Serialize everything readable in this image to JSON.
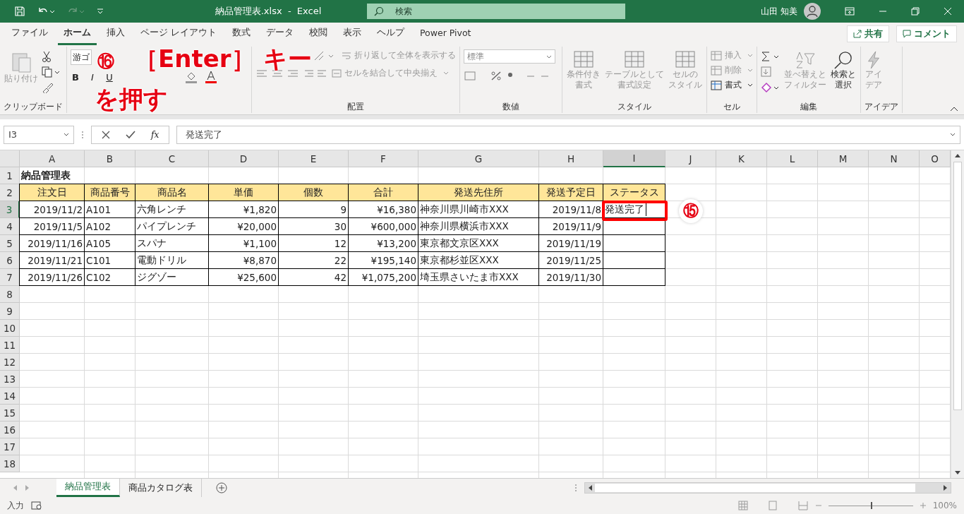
{
  "title_bar": {
    "title": "納品管理表.xlsx  -  Excel",
    "search": {
      "placeholder": "検索"
    },
    "user": "山田 知美"
  },
  "menu_tabs": [
    {
      "label": "ファイル",
      "selected": false
    },
    {
      "label": "ホーム",
      "selected": true
    },
    {
      "label": "挿入",
      "selected": false
    },
    {
      "label": "ページ レイアウト",
      "selected": false
    },
    {
      "label": "数式",
      "selected": false
    },
    {
      "label": "データ",
      "selected": false
    },
    {
      "label": "校閲",
      "selected": false
    },
    {
      "label": "表示",
      "selected": false
    },
    {
      "label": "ヘルプ",
      "selected": false
    },
    {
      "label": "Power Pivot",
      "selected": false
    }
  ],
  "share_button": "共有",
  "comment_button": "コメント",
  "ribbon": {
    "clipboard": {
      "paste": {
        "label": "貼り付け",
        "disabled": true
      },
      "label": "クリップボード"
    },
    "font": {
      "font_name": "游ゴ",
      "bold": "B",
      "italic": "I",
      "underline": "U"
    },
    "alignment": {
      "wrap": {
        "label": "折り返して全体を表示する",
        "disabled": true
      },
      "merge": {
        "label": "セルを結合して中央揃え",
        "disabled": true
      },
      "label": "配置"
    },
    "number": {
      "format": "標準",
      "label": "数値"
    },
    "styles": {
      "buttons": [
        {
          "lines": [
            "条件付き",
            "書式"
          ],
          "disabled": true
        },
        {
          "lines": [
            "テーブルとして",
            "書式設定"
          ],
          "disabled": true
        },
        {
          "lines": [
            "セルの",
            "スタイル"
          ],
          "disabled": true
        }
      ],
      "label": "スタイル"
    },
    "cells": {
      "buttons": [
        {
          "label": "挿入",
          "disabled": true
        },
        {
          "label": "削除",
          "disabled": true
        },
        {
          "label": "書式",
          "disabled": false
        }
      ],
      "label": "セル"
    },
    "editing": {
      "buttons": [
        {
          "lines": [
            "並べ替えと",
            "フィルター"
          ],
          "disabled": true
        },
        {
          "lines": [
            "検索と",
            "選択"
          ],
          "disabled": false
        }
      ],
      "label": "編集"
    },
    "ideas": {
      "lines": [
        "アイ",
        "デア"
      ],
      "disabled": true,
      "label": "アイデア"
    }
  },
  "formula_bar": {
    "name_box": "I3",
    "function_button": "fx",
    "formula": "発送完了"
  },
  "sheet": {
    "columns": [
      {
        "letter": "A",
        "selected": false
      },
      {
        "letter": "B",
        "selected": false
      },
      {
        "letter": "C",
        "selected": false
      },
      {
        "letter": "D",
        "selected": false
      },
      {
        "letter": "E",
        "selected": false
      },
      {
        "letter": "F",
        "selected": false
      },
      {
        "letter": "G",
        "selected": false
      },
      {
        "letter": "H",
        "selected": false
      },
      {
        "letter": "I",
        "selected": true
      },
      {
        "letter": "J",
        "selected": false
      },
      {
        "letter": "K",
        "selected": false
      },
      {
        "letter": "L",
        "selected": false
      },
      {
        "letter": "M",
        "selected": false
      },
      {
        "letter": "N",
        "selected": false
      },
      {
        "letter": "O",
        "selected": false
      }
    ],
    "rows": [
      {
        "number": "1",
        "kind": "title",
        "selected": false,
        "cells": [
          "納品管理表"
        ]
      },
      {
        "number": "2",
        "kind": "header",
        "selected": false,
        "cells": [
          "注文日",
          "商品番号",
          "商品名",
          "単価",
          "個数",
          "合計",
          "発送先住所",
          "発送予定日",
          "ステータス"
        ]
      },
      {
        "number": "3",
        "kind": "record",
        "selected": true,
        "cells": [
          "2019/11/2",
          "A101",
          "六角レンチ",
          "¥1,820",
          "9",
          "¥16,380",
          "神奈川県川崎市XXX",
          "2019/11/8",
          "発送完了"
        ]
      },
      {
        "number": "4",
        "kind": "record",
        "selected": false,
        "cells": [
          "2019/11/5",
          "A102",
          "パイプレンチ",
          "¥20,000",
          "30",
          "¥600,000",
          "神奈川県横浜市XXX",
          "2019/11/9"
        ]
      },
      {
        "number": "5",
        "kind": "record",
        "selected": false,
        "cells": [
          "2019/11/16",
          "A105",
          "スパナ",
          "¥1,100",
          "12",
          "¥13,200",
          "東京都文京区XXX",
          "2019/11/19"
        ]
      },
      {
        "number": "6",
        "kind": "record",
        "selected": false,
        "cells": [
          "2019/11/21",
          "C101",
          "電動ドリル",
          "¥8,870",
          "22",
          "¥195,140",
          "東京都杉並区XXX",
          "2019/11/25"
        ]
      },
      {
        "number": "7",
        "kind": "record",
        "selected": false,
        "cells": [
          "2019/11/26",
          "C102",
          "ジグゾー",
          "¥25,600",
          "42",
          "¥1,075,200",
          "埼玉県さいたま市XXX",
          "2019/11/30"
        ]
      },
      {
        "number": "8",
        "kind": "empty",
        "selected": false
      },
      {
        "number": "9",
        "kind": "empty",
        "selected": false
      },
      {
        "number": "10",
        "kind": "empty",
        "selected": false
      },
      {
        "number": "11",
        "kind": "empty",
        "selected": false
      },
      {
        "number": "12",
        "kind": "empty",
        "selected": false
      },
      {
        "number": "13",
        "kind": "empty",
        "selected": false
      },
      {
        "number": "14",
        "kind": "empty",
        "selected": false
      },
      {
        "number": "15",
        "kind": "empty",
        "selected": false
      },
      {
        "number": "16",
        "kind": "empty",
        "selected": false
      },
      {
        "number": "17",
        "kind": "empty",
        "selected": false
      },
      {
        "number": "18",
        "kind": "empty",
        "selected": false
      }
    ]
  },
  "annotations": [
    {
      "kind": "instruction",
      "number": "⑯",
      "lines": [
        "［Enter］ キー",
        "を押す"
      ]
    },
    {
      "kind": "callout",
      "number": "⑮"
    }
  ],
  "sheet_tabs": [
    {
      "label": "納品管理表",
      "selected": true
    },
    {
      "label": "商品カタログ表",
      "selected": false
    }
  ],
  "status_bar": {
    "mode": "入力",
    "zoom_slider": {
      "level": 0.5
    },
    "zoom": "100%"
  }
}
